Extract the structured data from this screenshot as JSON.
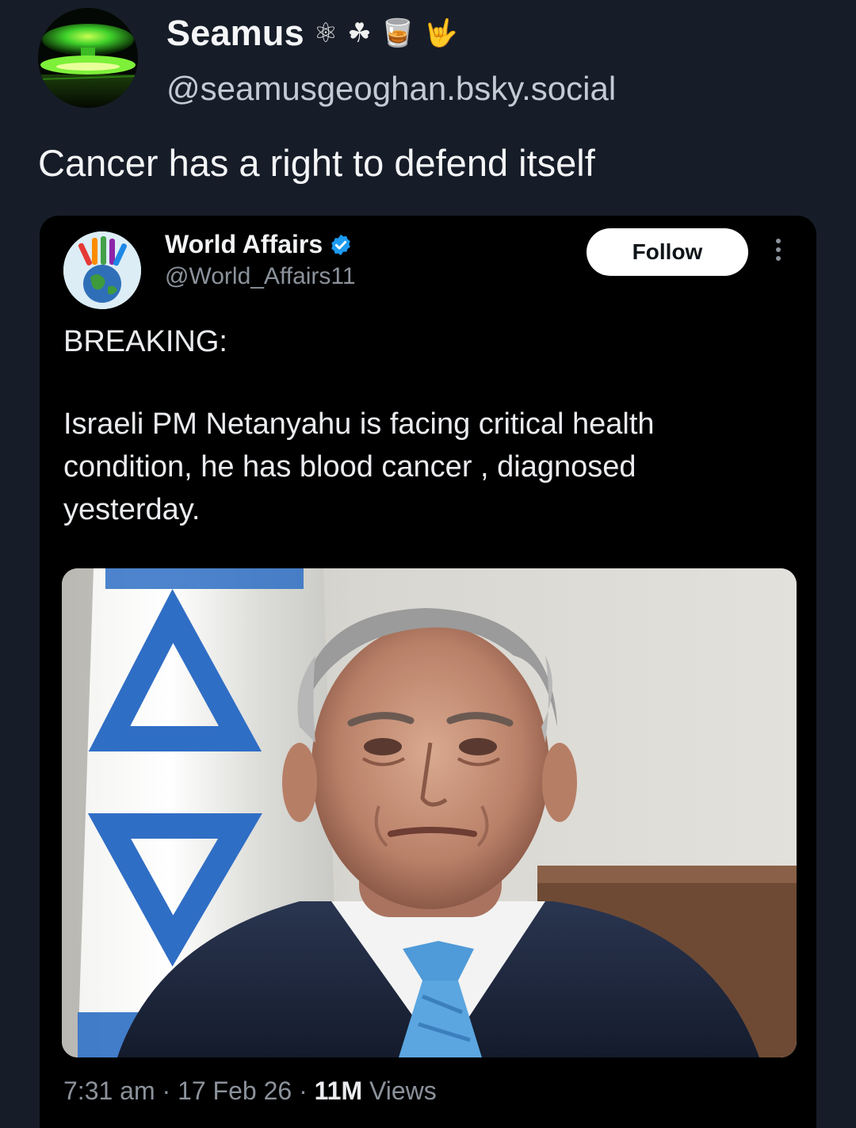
{
  "post": {
    "display_name": "Seamus",
    "name_emojis": [
      "⚛",
      "☘",
      "🥃",
      "🤟"
    ],
    "handle": "@seamusgeoghan.bsky.social",
    "text": "Cancer has a right to defend itself"
  },
  "embed": {
    "display_name": "World Affairs",
    "verified": true,
    "handle": "@World_Affairs11",
    "follow_label": "Follow",
    "breaking": "BREAKING:",
    "body_lines": [
      "Israeli PM Netanyahu is facing critical health",
      "condition, he has blood cancer , diagnosed",
      "yesterday."
    ],
    "meta": {
      "time": "7:31 am",
      "separator": "·",
      "date": "17 Feb 26",
      "views_count": "11M",
      "views_label": "Views"
    }
  },
  "colors": {
    "page_background": "#161d28",
    "card_background": "#000000",
    "verified_blue": "#1d9bf0",
    "muted_text": "#8b929b"
  },
  "icons": {
    "more": "more-vertical-icon",
    "verified": "verified-badge-icon"
  }
}
